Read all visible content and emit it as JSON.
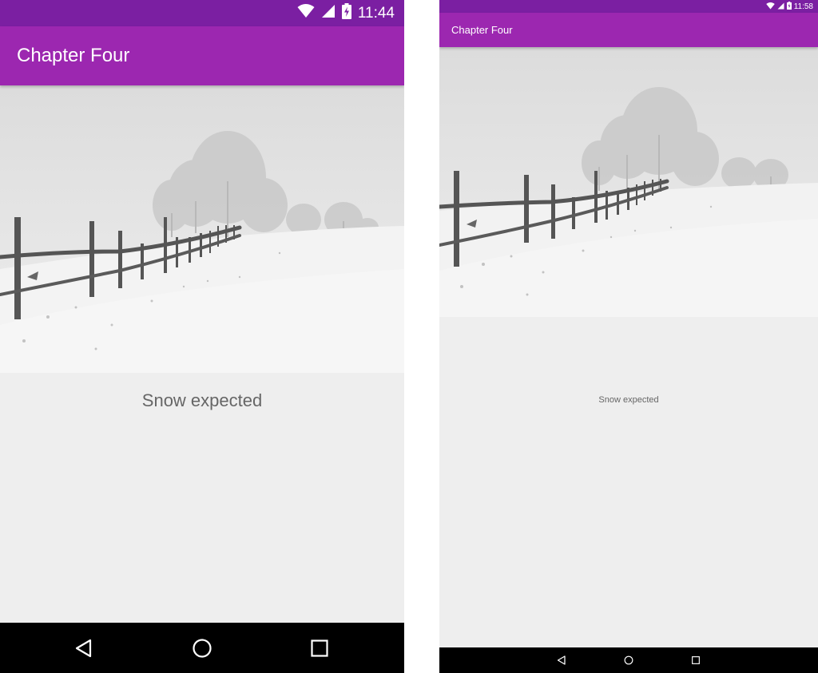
{
  "left_phone": {
    "status_bar": {
      "time": "11:44",
      "icons": [
        "wifi-icon",
        "cell-signal-icon",
        "battery-charging-icon"
      ]
    },
    "app_bar": {
      "title": "Chapter Four"
    },
    "hero_image": {
      "subject": "snowy field with wooden fence and trees"
    },
    "caption": "Snow expected",
    "nav_bar": {
      "buttons": [
        "back-icon",
        "home-icon",
        "recents-icon"
      ]
    }
  },
  "right_phone": {
    "status_bar": {
      "time": "11:58",
      "icons": [
        "wifi-icon",
        "cell-signal-icon",
        "battery-charging-icon"
      ]
    },
    "app_bar": {
      "title": "Chapter Four"
    },
    "hero_image": {
      "subject": "snowy field with wooden fence and trees"
    },
    "caption": "Snow expected",
    "nav_bar": {
      "buttons": [
        "back-icon",
        "home-icon",
        "recents-icon"
      ]
    }
  },
  "colors": {
    "status_bar": "#7b1fa2",
    "app_bar": "#9c27b0",
    "content_background": "#eeeeee",
    "nav_bar": "#000000",
    "caption_text": "#666666"
  }
}
